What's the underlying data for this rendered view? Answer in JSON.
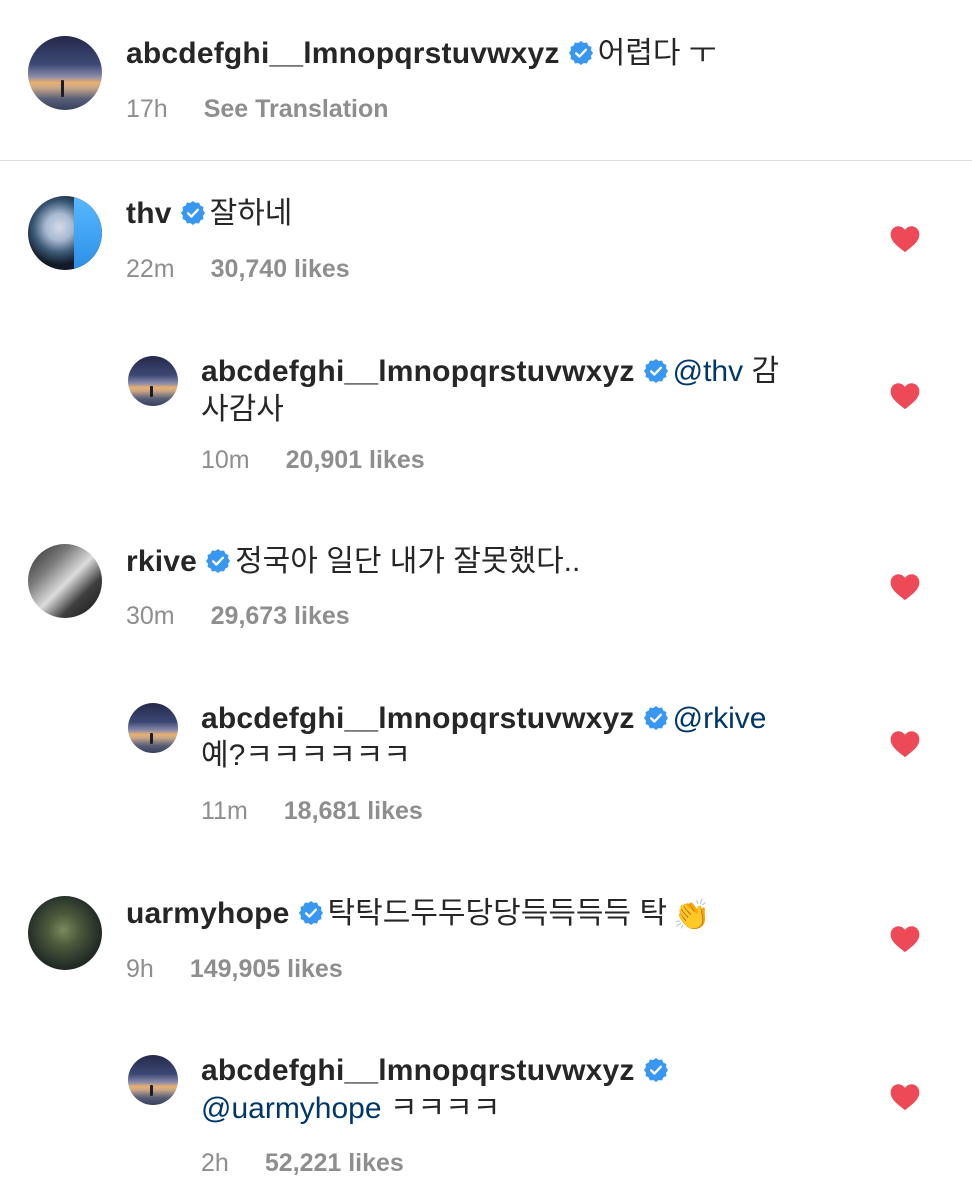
{
  "caption": {
    "username": "abcdefghi__lmnopqrstuvwxyz",
    "text": "어렵다 ㅜ",
    "time": "17h",
    "translate_label": "See Translation"
  },
  "comments": [
    {
      "username": "thv",
      "text": "잘하네",
      "time": "22m",
      "likes": "30,740 likes",
      "reply": {
        "username": "abcdefghi__lmnopqrstuvwxyz",
        "mention": "@thv",
        "text_line1_end": "감",
        "text_line2": "사감사",
        "time": "10m",
        "likes": "20,901 likes"
      }
    },
    {
      "username": "rkive",
      "text": "정국아 일단 내가 잘못했다..",
      "time": "30m",
      "likes": "29,673 likes",
      "reply": {
        "username": "abcdefghi__lmnopqrstuvwxyz",
        "mention": "@rkive",
        "text_line2": "예?ㅋㅋㅋㅋㅋㅋ",
        "time": "11m",
        "likes": "18,681 likes"
      }
    },
    {
      "username": "uarmyhope",
      "text": "탁탁드두두당당득득득득 탁",
      "emoji": "👏",
      "time": "9h",
      "likes": "149,905 likes",
      "reply": {
        "username": "abcdefghi__lmnopqrstuvwxyz",
        "mention": "@uarmyhope",
        "text_line2_end": "ㅋㅋㅋㅋ",
        "time": "2h",
        "likes": "52,221 likes"
      }
    }
  ],
  "colors": {
    "verified": "#3897f0",
    "heart": "#ed4956",
    "mention": "#00376b",
    "meta": "#8e8e8e"
  },
  "icons": [
    "verified-badge-icon",
    "heart-icon",
    "clapping-hands-emoji"
  ]
}
